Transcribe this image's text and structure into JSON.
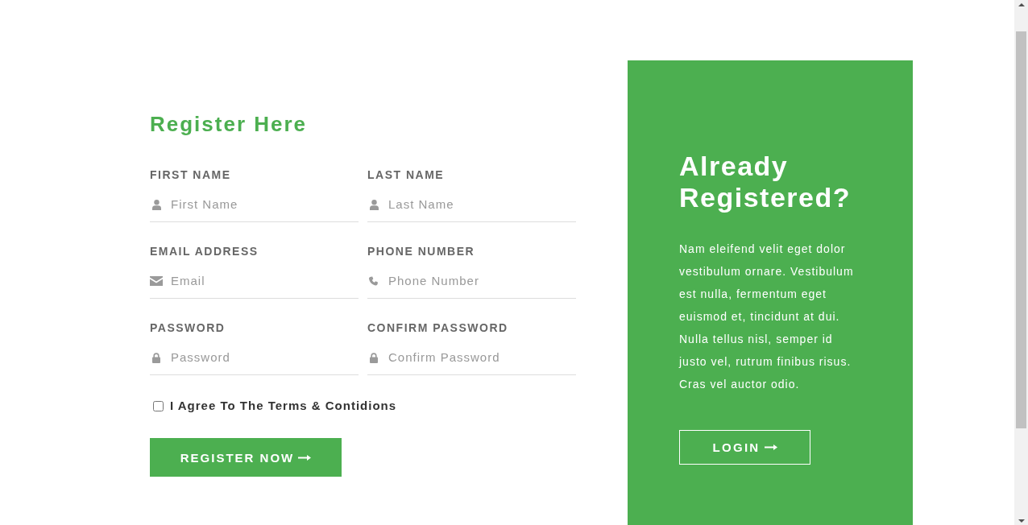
{
  "register": {
    "title": "Register Here",
    "fields": [
      {
        "kind": "name",
        "label": "FIRST NAME",
        "placeholder": "First Name"
      },
      {
        "kind": "name",
        "label": "LAST NAME",
        "placeholder": "Last Name"
      },
      {
        "kind": "email",
        "label": "EMAIL ADDRESS",
        "placeholder": "Email"
      },
      {
        "kind": "phone",
        "label": "PHONE NUMBER",
        "placeholder": "Phone Number"
      },
      {
        "kind": "password",
        "label": "PASSWORD",
        "placeholder": "Password"
      },
      {
        "kind": "password",
        "label": "CONFIRM PASSWORD",
        "placeholder": "Confirm Password"
      }
    ],
    "terms": {
      "label": "I Agree To The Terms & Contidions",
      "checked": false
    },
    "submit_button": "REGISTER NOW"
  },
  "login_panel": {
    "title": "Already Registered?",
    "text": "Nam eleifend velit eget dolor vestibulum ornare. Vestibulum est nulla, fermentum eget euismod et, tincidunt at dui. Nulla tellus nisl, semper id justo vel, rutrum finibus risus. Cras vel auctor odio.",
    "button": "LOGIN"
  }
}
